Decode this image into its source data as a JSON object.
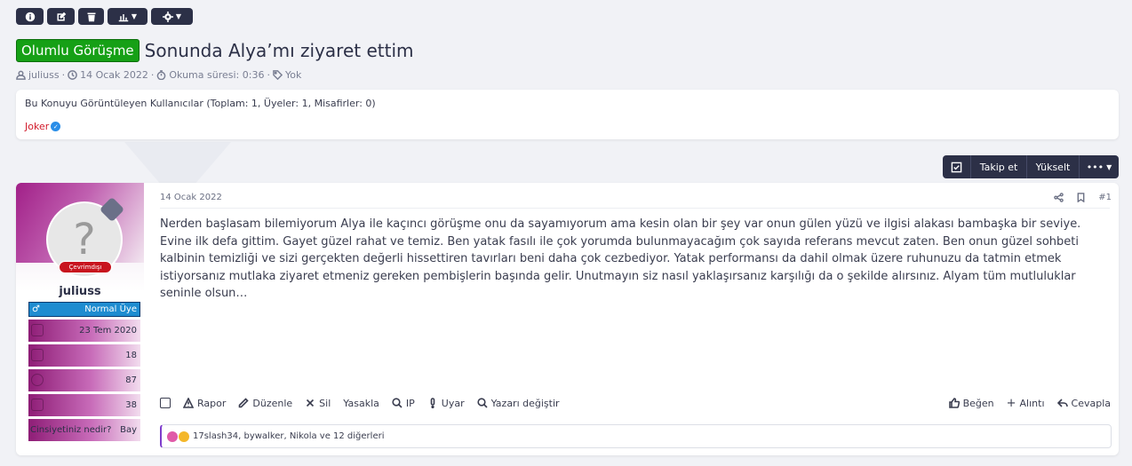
{
  "toolbar": {
    "items": [
      "info-icon",
      "edit-icon",
      "trash-icon",
      "chart-icon",
      "gear-icon"
    ]
  },
  "thread": {
    "prefix": "Olumlu Görüşme",
    "title": "Sonunda Alya’mı ziyaret ettim",
    "author": "juliuss",
    "date": "14 Ocak 2022",
    "read_time": "Okuma süresi: 0:36",
    "tags": "Yok"
  },
  "viewers": {
    "heading": "Bu Konuyu Görüntüleyen Kullanıcılar (Toplam: 1, Üyeler: 1, Misafirler: 0)",
    "user": "Joker"
  },
  "actions": {
    "follow": "Takip et",
    "bump": "Yükselt"
  },
  "post": {
    "date": "14 Ocak 2022",
    "number": "#1",
    "body": "Nerden başlasam bilemiyorum Alya ile kaçıncı görüşme onu da sayamıyorum ama kesin olan bir şey var onun gülen yüzü ve ilgisi alakası bambaşka bir seviye. Evine ilk defa gittim. Gayet güzel rahat ve temiz. Ben yatak fasılı ile çok yorumda bulunmayacağım çok sayıda referans mevcut zaten. Ben onun güzel sohbeti kalbinin temizliği ve sizi gerçekten değerli hissettiren tavırları beni daha çok cezbediyor. Yatak performansı da dahil olmak üzere ruhunuzu da tatmin etmek istiyorsanız mutlaka ziyaret etmeniz gereken pembişlerin başında gelir. Unutmayın siz nasıl yaklaşırsanız karşılığı da o şekilde alırsınız. Alyam tüm mutluluklar seninle olsun…",
    "footer_left": [
      "Rapor",
      "Düzenle",
      "Sil",
      "Yasakla",
      "IP",
      "Uyar",
      "Yazarı değiştir"
    ],
    "footer_right": [
      "Beğen",
      "Alıntı",
      "Cevapla"
    ],
    "reactions_text": "17slash34, bywalker, Nikola ve 12 diğerleri"
  },
  "user": {
    "avatar_letter": "?",
    "status": "Çevrimdışı",
    "name": "juliuss",
    "gender_symbol": "♂",
    "role": "Normal Üye",
    "joined": "23 Tem 2020",
    "messages": "18",
    "reactions": "87",
    "points": "38",
    "gender_q": "Cinsiyetiniz nedir?",
    "gender_a": "Bay"
  }
}
